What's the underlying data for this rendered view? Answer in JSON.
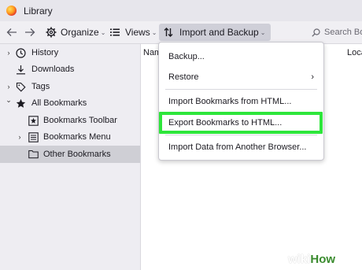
{
  "window": {
    "title": "Library"
  },
  "toolbar": {
    "back_icon": "arrow-left-icon",
    "forward_icon": "arrow-right-icon",
    "organize_label": "Organize",
    "views_label": "Views",
    "import_label": "Import and Backup",
    "search_placeholder": "Search Bo"
  },
  "sidebar": {
    "items": [
      {
        "label": "History",
        "icon": "clock-icon",
        "twisty": "›"
      },
      {
        "label": "Downloads",
        "icon": "download-icon",
        "twisty": ""
      },
      {
        "label": "Tags",
        "icon": "tag-icon",
        "twisty": "›"
      },
      {
        "label": "All Bookmarks",
        "icon": "star-icon",
        "twisty": "⌄"
      },
      {
        "label": "Bookmarks Toolbar",
        "icon": "bookmarks-toolbar-icon",
        "twisty": ""
      },
      {
        "label": "Bookmarks Menu",
        "icon": "bookmarks-menu-icon",
        "twisty": "›"
      },
      {
        "label": "Other Bookmarks",
        "icon": "folder-icon",
        "twisty": ""
      }
    ]
  },
  "content": {
    "columns": [
      "Nam",
      "Loca"
    ]
  },
  "menu": {
    "items": [
      {
        "label": "Backup..."
      },
      {
        "label": "Restore",
        "submenu": "›"
      },
      {
        "label": "Import Bookmarks from HTML..."
      },
      {
        "label": "Export Bookmarks to HTML..."
      },
      {
        "label": "Import Data from Another Browser..."
      }
    ]
  },
  "watermark": {
    "part1": "wiki",
    "part2": "How"
  },
  "colors": {
    "highlight": "#2ee63b",
    "selected_row": "#cfcfd5",
    "wikihow_green": "#3a8b2e"
  }
}
